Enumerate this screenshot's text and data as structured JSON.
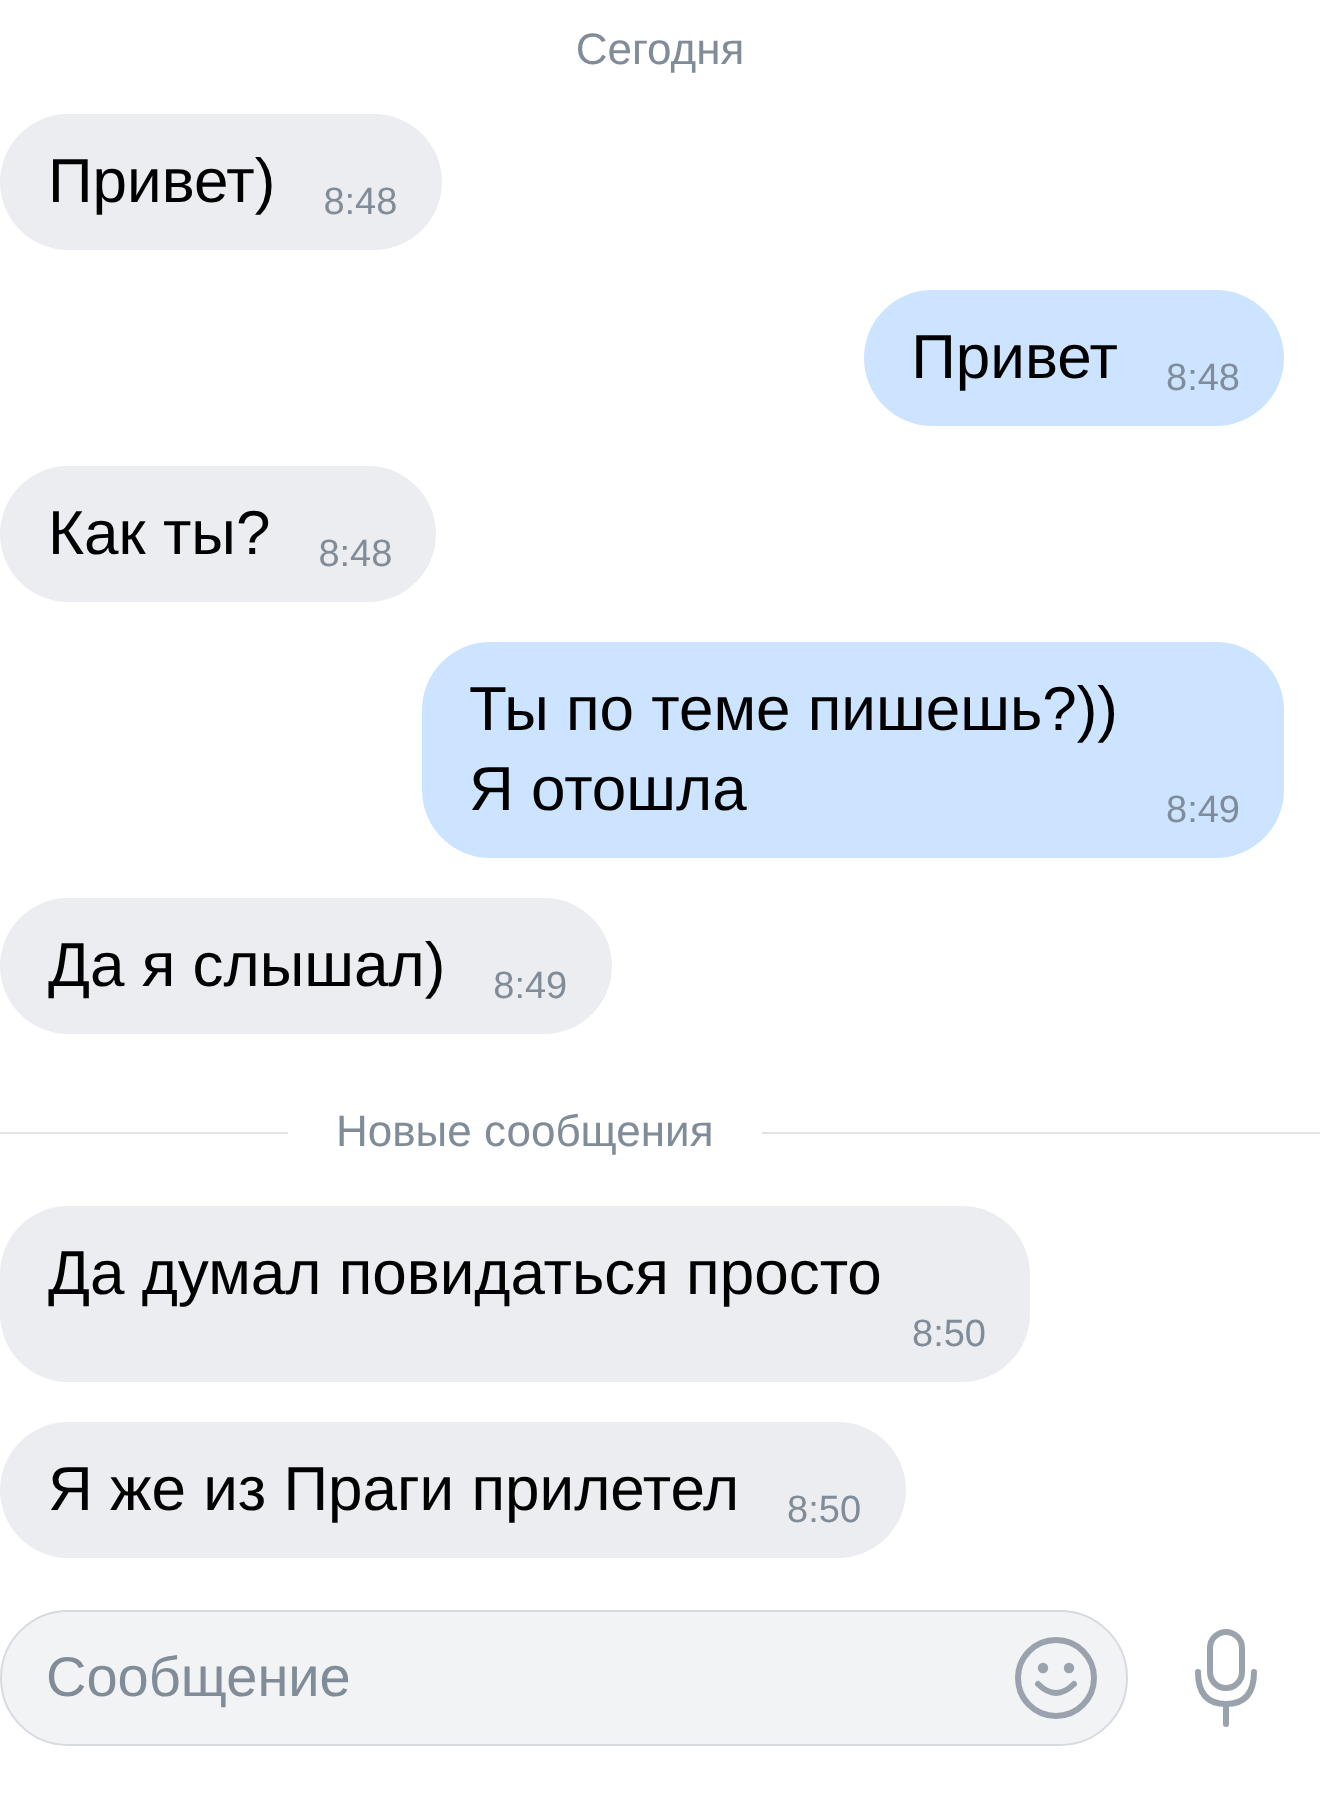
{
  "date_label": "Сегодня",
  "messages": [
    {
      "kind": "incoming",
      "text": "Привет)",
      "time": "8:48"
    },
    {
      "kind": "outgoing",
      "text": "Привет",
      "time": "8:48"
    },
    {
      "kind": "incoming",
      "text": "Как ты?",
      "time": "8:48"
    },
    {
      "kind": "outgoing",
      "text": "Ты по теме пишешь?))\nЯ отошла",
      "time": "8:49"
    },
    {
      "kind": "incoming",
      "text": "Да я слышал)",
      "time": "8:49"
    }
  ],
  "new_divider": "Новые сообщения",
  "new_messages": [
    {
      "kind": "incoming",
      "text": "Да думал повидаться просто",
      "time": "8:50"
    },
    {
      "kind": "incoming",
      "text": "Я же из Праги прилетел",
      "time": "8:50"
    }
  ],
  "composer": {
    "placeholder": "Сообщение"
  }
}
